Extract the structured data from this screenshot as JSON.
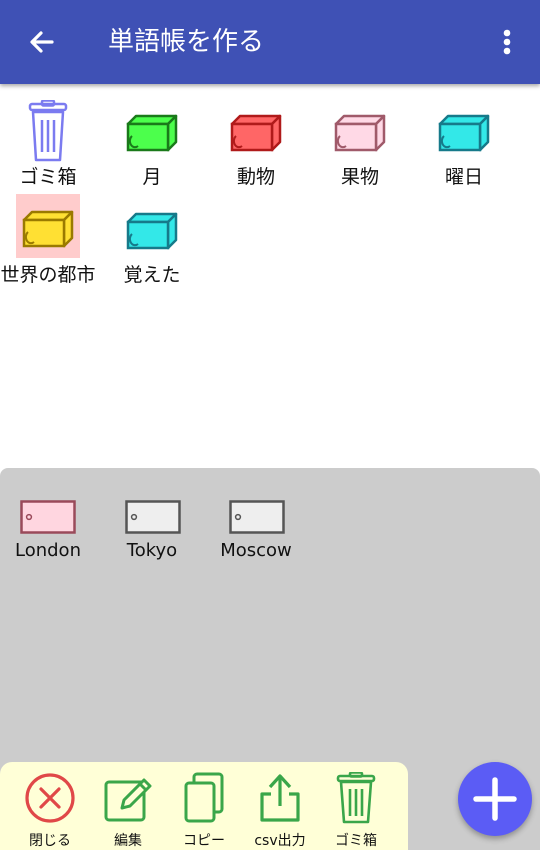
{
  "appbar": {
    "title": "単語帳を作る",
    "back_icon": "arrow-left-icon",
    "menu_icon": "more-vert-icon",
    "color": "#3f51b5"
  },
  "books": [
    {
      "label": "ゴミ箱",
      "icon": "trash-icon",
      "color": "#7b7bf0"
    },
    {
      "label": "月",
      "icon": "book-icon",
      "color": "#4cff4c"
    },
    {
      "label": "動物",
      "icon": "book-icon",
      "color": "#ff6666"
    },
    {
      "label": "果物",
      "icon": "book-icon",
      "color": "#ffd9e6"
    },
    {
      "label": "曜日",
      "icon": "book-icon",
      "color": "#33e8e8"
    },
    {
      "label": "世界の都市",
      "icon": "book-icon",
      "color": "#ffe033",
      "selected": true
    },
    {
      "label": "覚えた",
      "icon": "book-icon",
      "color": "#33e8e8"
    }
  ],
  "cards": [
    {
      "label": "London",
      "icon": "card-icon",
      "color": "#ffd6e0"
    },
    {
      "label": "Tokyo",
      "icon": "card-icon",
      "color": "#eeeeee"
    },
    {
      "label": "Moscow",
      "icon": "card-icon",
      "color": "#eeeeee"
    }
  ],
  "toolbar": {
    "close_label": "閉じる",
    "edit_label": "編集",
    "copy_label": "コピー",
    "csv_label": "csv出力",
    "trash_label": "ゴミ箱"
  },
  "fab": {
    "icon": "plus-icon",
    "color": "#5b5cf5"
  }
}
